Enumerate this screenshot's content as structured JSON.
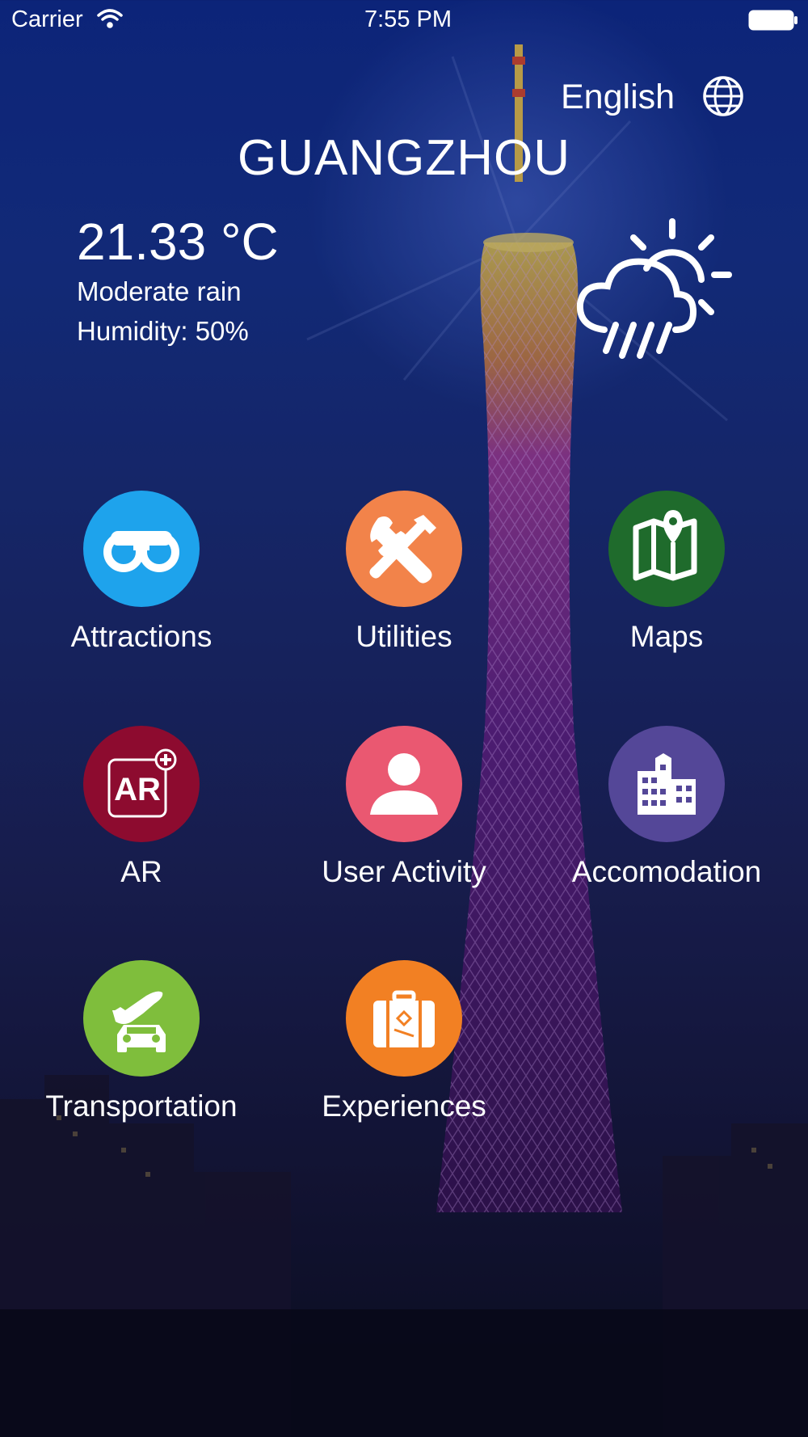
{
  "status_bar": {
    "carrier": "Carrier",
    "time": "7:55 PM"
  },
  "language": {
    "label": "English",
    "icon": "globe-icon"
  },
  "city": "GUANGZHOU",
  "weather": {
    "temperature": "21.33 °C",
    "condition": "Moderate rain",
    "humidity": "Humidity: 50%",
    "icon": "cloud-sun-rain-icon"
  },
  "menu": [
    {
      "label": "Attractions",
      "icon": "binoculars-icon",
      "color": "#1ea3ec"
    },
    {
      "label": "Utilities",
      "icon": "tools-icon",
      "color": "#f2834a"
    },
    {
      "label": "Maps",
      "icon": "map-pin-icon",
      "color": "#1f6b2c"
    },
    {
      "label": "AR",
      "icon": "ar-add-icon",
      "color": "#8d0b2f"
    },
    {
      "label": "User Activity",
      "icon": "user-icon",
      "color": "#ea5871"
    },
    {
      "label": "Accomodation",
      "icon": "building-icon",
      "color": "#544798"
    },
    {
      "label": "Transportation",
      "icon": "plane-car-icon",
      "color": "#7fbe3c"
    },
    {
      "label": "Experiences",
      "icon": "suitcase-icon",
      "color": "#f28023"
    }
  ]
}
